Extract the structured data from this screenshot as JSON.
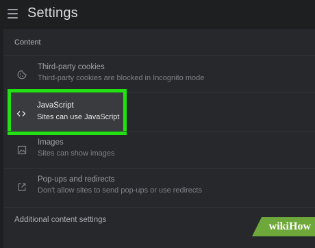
{
  "header": {
    "title": "Settings"
  },
  "content": {
    "section_label": "Content",
    "items": [
      {
        "title": "Third-party cookies",
        "description": "Third-party cookies are blocked in Incognito mode",
        "icon": "cookie-icon"
      },
      {
        "title": "JavaScript",
        "description": "Sites can use JavaScript",
        "icon": "code-icon",
        "highlighted": true
      },
      {
        "title": "Images",
        "description": "Sites can show images",
        "icon": "image-icon"
      },
      {
        "title": "Pop-ups and redirects",
        "description": "Don't allow sites to send pop-ups or use redirects",
        "icon": "external-link-icon"
      }
    ],
    "additional_label": "Additional content settings"
  },
  "watermark": {
    "part1": "wiki",
    "part2": "How"
  },
  "colors": {
    "highlight_border": "#22e011",
    "watermark_bg": "#6ea83a"
  }
}
